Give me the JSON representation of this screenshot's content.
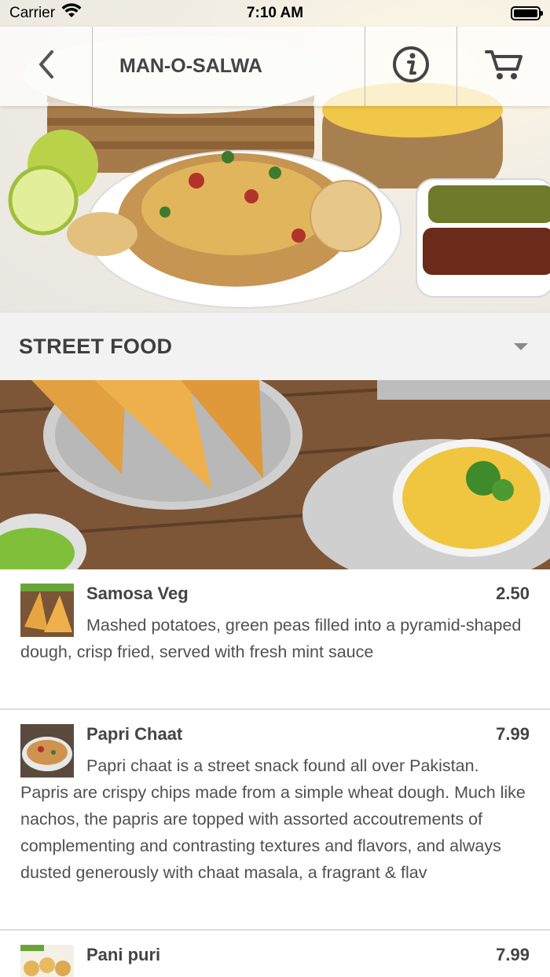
{
  "status_bar": {
    "carrier": "Carrier",
    "time": "7:10 AM"
  },
  "header": {
    "back_icon": "chevron-left-icon",
    "title": "MAN-O-SALWA",
    "info_icon": "info-circle-icon",
    "cart_icon": "shopping-cart-icon"
  },
  "category": {
    "title": "STREET FOOD",
    "caret_icon": "caret-down-icon"
  },
  "menu_items": [
    {
      "name": "Samosa Veg",
      "price": "2.50",
      "description": "Mashed potatoes, green peas filled into a pyramid-shaped dough, crisp fried, served with fresh mint sauce"
    },
    {
      "name": "Papri Chaat",
      "price": "7.99",
      "description": "Papri chaat is a street snack found all over Pakistan. Papris are crispy chips made from a simple wheat dough. Much like nachos, the papris are topped with assorted accoutrements of complementing and contrasting textures and flavors, and always dusted generously with chaat masala, a fragrant & flav"
    },
    {
      "name": "Pani puri",
      "price": "7.99",
      "description": ""
    }
  ],
  "colors": {
    "text_dark": "#444444",
    "category_bg": "#f2f2f2",
    "divider": "#dcdcdc"
  }
}
